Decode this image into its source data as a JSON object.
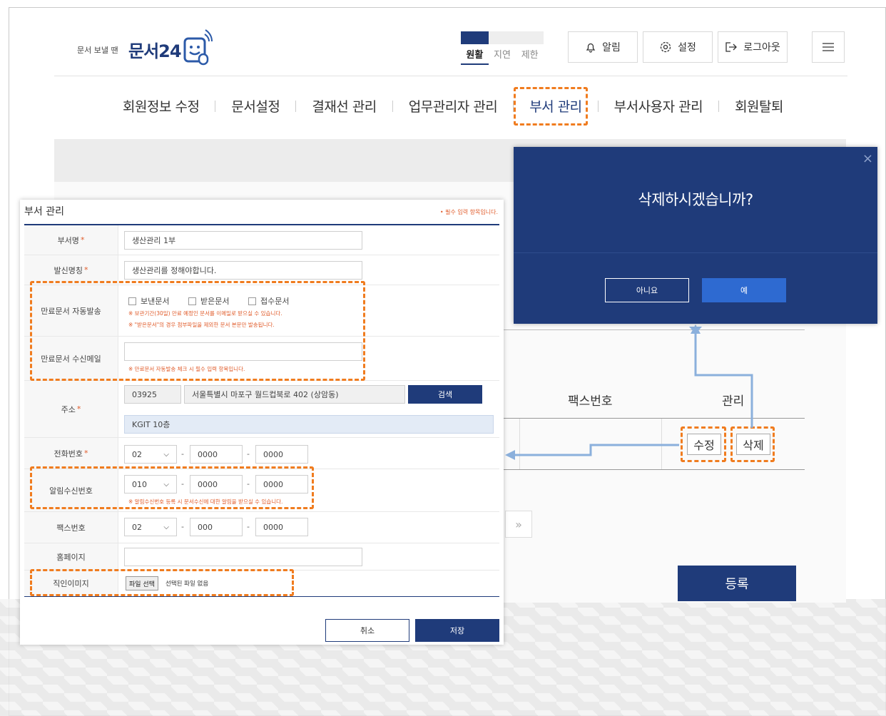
{
  "header": {
    "logo_small": "문서 보낼 땐",
    "logo_big": "문서24",
    "status_tabs": [
      "원활",
      "지연",
      "제한"
    ],
    "buttons": {
      "alarm": "알림",
      "settings": "설정",
      "logout": "로그아웃"
    }
  },
  "nav": {
    "items": [
      "회원정보 수정",
      "문서설정",
      "결재선 관리",
      "업무관리자 관리",
      "부서 관리",
      "부서사용자 관리",
      "회원탈퇴"
    ]
  },
  "background_table": {
    "headers": [
      "팩스번호",
      "관리"
    ],
    "edit_label": "수정",
    "delete_label": "삭제",
    "page_next": "»",
    "register_label": "등록"
  },
  "form": {
    "title": "부서 관리",
    "required_note": "• 필수 입력 항목입니다.",
    "rows": {
      "dept_name": {
        "label": "부서명",
        "value": "생산관리 1부"
      },
      "sender_name": {
        "label": "발신명칭",
        "value": "생산관리를 정해야합니다."
      },
      "auto_send": {
        "label": "만료문서 자동발송",
        "options": [
          "보낸문서",
          "받은문서",
          "접수문서"
        ],
        "note1": "※ 보관기간(30일) 만료 예정인 문서를 이메일로 받으실 수 있습니다.",
        "note2": "※ \"받은문서\"의 경우 첨부파일을 제외한 문서 본문만 발송됩니다."
      },
      "recv_email": {
        "label": "만료문서 수신메일",
        "note": "※ 만료문서 자동발송 체크 시 필수 입력 항목입니다."
      },
      "address": {
        "label": "주소",
        "zip": "03925",
        "addr1": "서울특별시 마포구 월드컵북로 402 (상암동)",
        "addr2": "KGIT 10층",
        "search": "검색"
      },
      "phone": {
        "label": "전화번호",
        "p1": "02",
        "p2": "0000",
        "p3": "0000"
      },
      "alarm_phone": {
        "label": "알림수신번호",
        "p1": "010",
        "p2": "0000",
        "p3": "0000",
        "note": "※ 알림수신번호 등록 시 문서수신에 대한 알림을 받으실 수 있습니다."
      },
      "fax": {
        "label": "팩스번호",
        "p1": "02",
        "p2": "000",
        "p3": "0000"
      },
      "homepage": {
        "label": "홈페이지"
      },
      "seal_image": {
        "label": "직인이미지",
        "file_btn": "파일 선택",
        "file_status": "선택된 파일 없음"
      }
    },
    "cancel": "취소",
    "save": "저장"
  },
  "dialog": {
    "message": "삭제하시겠습니까?",
    "no": "아니요",
    "yes": "예",
    "close": "×"
  },
  "colors": {
    "primary": "#1f3b7a",
    "highlight": "#f07c1f",
    "arrow": "#8bb0dc"
  }
}
